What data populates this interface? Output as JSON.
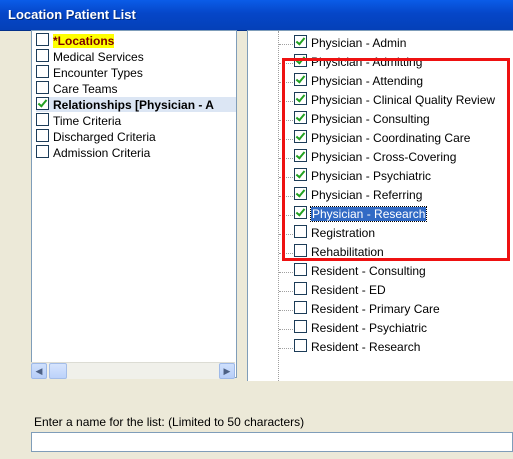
{
  "window": {
    "title": "Location Patient List"
  },
  "left_list": {
    "items": [
      {
        "label": "*Locations",
        "checked": false,
        "style": "highlight"
      },
      {
        "label": "Medical Services",
        "checked": false,
        "style": "normal"
      },
      {
        "label": "Encounter Types",
        "checked": false,
        "style": "normal"
      },
      {
        "label": "Care Teams",
        "checked": false,
        "style": "normal"
      },
      {
        "label": "Relationships [Physician - A",
        "checked": true,
        "style": "bold-selected"
      },
      {
        "label": "Time Criteria",
        "checked": false,
        "style": "normal"
      },
      {
        "label": "Discharged Criteria",
        "checked": false,
        "style": "normal"
      },
      {
        "label": "Admission Criteria",
        "checked": false,
        "style": "normal"
      }
    ]
  },
  "right_tree": {
    "items": [
      {
        "label": "Physician - Admin",
        "checked": true
      },
      {
        "label": "Physician - Admitting",
        "checked": true
      },
      {
        "label": "Physician - Attending",
        "checked": true
      },
      {
        "label": "Physician - Clinical Quality Review",
        "checked": true
      },
      {
        "label": "Physician - Consulting",
        "checked": true
      },
      {
        "label": "Physician - Coordinating Care",
        "checked": true
      },
      {
        "label": "Physician - Cross-Covering",
        "checked": true
      },
      {
        "label": "Physician - Psychiatric",
        "checked": true
      },
      {
        "label": "Physician - Referring",
        "checked": true
      },
      {
        "label": "Physician - Research",
        "checked": true,
        "selected": true
      },
      {
        "label": "Registration",
        "checked": false
      },
      {
        "label": "Rehabilitation",
        "checked": false
      },
      {
        "label": "Resident - Consulting",
        "checked": false
      },
      {
        "label": "Resident - ED",
        "checked": false
      },
      {
        "label": "Resident - Primary Care",
        "checked": false
      },
      {
        "label": "Resident - Psychiatric",
        "checked": false
      },
      {
        "label": "Resident - Research",
        "checked": false
      }
    ]
  },
  "name_field": {
    "label": "Enter a name for the list: (Limited to 50 characters)",
    "value": ""
  },
  "colors": {
    "titlebar": "#0546c8",
    "highlight_box": "#ee1111",
    "selection": "#316ac5"
  }
}
